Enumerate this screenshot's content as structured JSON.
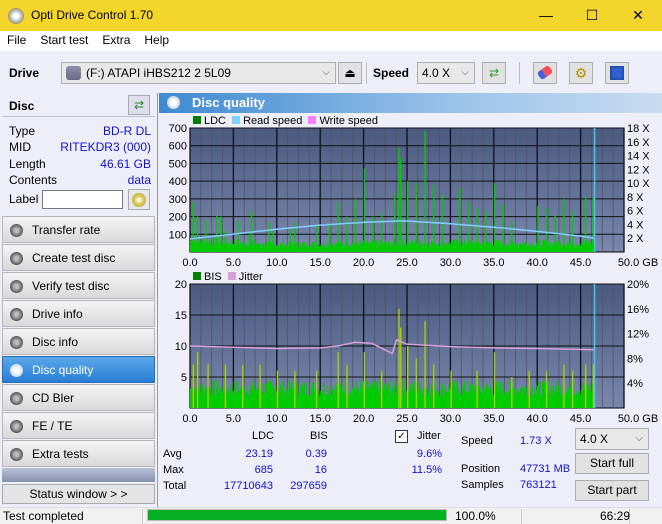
{
  "window": {
    "title": "Opti Drive Control 1.70",
    "minimize": "—",
    "maximize": "☐",
    "close": "✕"
  },
  "menu": [
    "File",
    "Start test",
    "Extra",
    "Help"
  ],
  "toolbar": {
    "drive_label": "Drive",
    "drive_value": "(F:)  ATAPI iHBS212  2 5L09",
    "speed_label": "Speed",
    "speed_value": "4.0 X",
    "eject_glyph": "⏏",
    "chevron": "⌵"
  },
  "disc": {
    "header": "Disc",
    "rows": [
      {
        "key": "Type",
        "value": "BD-R DL"
      },
      {
        "key": "MID",
        "value": "RITEKDR3 (000)"
      },
      {
        "key": "Length",
        "value": "46.61 GB"
      },
      {
        "key": "Contents",
        "value": "data"
      }
    ],
    "label_key": "Label",
    "label_value": ""
  },
  "nav": [
    {
      "label": "Transfer rate",
      "active": false
    },
    {
      "label": "Create test disc",
      "active": false
    },
    {
      "label": "Verify test disc",
      "active": false
    },
    {
      "label": "Drive info",
      "active": false
    },
    {
      "label": "Disc info",
      "active": false
    },
    {
      "label": "Disc quality",
      "active": true
    },
    {
      "label": "CD Bler",
      "active": false
    },
    {
      "label": "FE / TE",
      "active": false
    },
    {
      "label": "Extra tests",
      "active": false
    }
  ],
  "status_window_button": "Status window > >",
  "panel_title": "Disc quality",
  "colors": {
    "ldc": "#008000",
    "read_speed": "#80d0ff",
    "write_speed": "#ff80ff",
    "bis": "#008000",
    "jitter": "#d8a0d8",
    "bar_green": "#00cc00",
    "plot_bg_top": "#4a5a80",
    "plot_bg_bottom": "#7a88b0",
    "link_blue": "#1010d0"
  },
  "chart_data": [
    {
      "type": "bar",
      "title": "LDC / Read speed",
      "legend": [
        "LDC",
        "Read speed",
        "Write speed"
      ],
      "xlabel": "GB",
      "xlim": [
        0,
        50
      ],
      "x_ticks": [
        "0.0",
        "5.0",
        "10.0",
        "15.0",
        "20.0",
        "25.0",
        "30.0",
        "35.0",
        "40.0",
        "45.0",
        "50.0 GB"
      ],
      "ylim": [
        0,
        700
      ],
      "y_ticks": [
        "100",
        "200",
        "300",
        "400",
        "500",
        "600",
        "700"
      ],
      "y2lim": [
        0,
        18
      ],
      "y2_ticks": [
        "2 X",
        "4 X",
        "6 X",
        "8 X",
        "10 X",
        "12 X",
        "14 X",
        "16 X",
        "18 X"
      ],
      "end_marker_gb": 46.61,
      "series": [
        {
          "name": "LDC peaks",
          "x": [
            0.3,
            0.8,
            1.8,
            3.0,
            3.5,
            4.0,
            5.5,
            6.8,
            7.0,
            9.0,
            9.5,
            11.5,
            12.0,
            14.5,
            16.0,
            17.0,
            18.0,
            19.0,
            20.0,
            21.0,
            22.0,
            23.5,
            24.0,
            24.2,
            25.0,
            26.0,
            27.0,
            28.0,
            29.0,
            31.0,
            32.0,
            33.0,
            34.0,
            35.0,
            36.0,
            37.0,
            40.0,
            41.0,
            42.0,
            43.0,
            44.0,
            45.5,
            46.4
          ],
          "values": [
            280,
            200,
            180,
            210,
            200,
            120,
            180,
            100,
            230,
            170,
            120,
            130,
            170,
            150,
            160,
            280,
            200,
            300,
            470,
            200,
            220,
            330,
            590,
            530,
            400,
            390,
            685,
            380,
            320,
            360,
            280,
            250,
            230,
            390,
            270,
            170,
            260,
            250,
            210,
            300,
            230,
            310,
            310
          ]
        },
        {
          "name": "LDC baseline",
          "x": [
            0,
            10,
            20,
            30,
            40,
            46.61
          ],
          "values": [
            60,
            40,
            45,
            50,
            45,
            50
          ]
        },
        {
          "name": "Read speed",
          "x": [
            0,
            5,
            10,
            15,
            20,
            24,
            25,
            30,
            35,
            40,
            45,
            46.61
          ],
          "values": [
            1.9,
            2.6,
            3.3,
            3.9,
            4.3,
            4.5,
            4.5,
            4.1,
            3.6,
            3.0,
            2.3,
            2.0
          ]
        }
      ]
    },
    {
      "type": "bar",
      "title": "BIS / Jitter",
      "legend": [
        "BIS",
        "Jitter"
      ],
      "xlabel": "GB",
      "xlim": [
        0,
        50
      ],
      "x_ticks": [
        "0.0",
        "5.0",
        "10.0",
        "15.0",
        "20.0",
        "25.0",
        "30.0",
        "35.0",
        "40.0",
        "45.0",
        "50.0 GB"
      ],
      "ylim": [
        0,
        20
      ],
      "y_ticks": [
        "5",
        "10",
        "15",
        "20"
      ],
      "y2lim": [
        0,
        20
      ],
      "y2_ticks": [
        "4%",
        "8%",
        "12%",
        "16%",
        "20%"
      ],
      "end_marker_gb": 46.61,
      "series": [
        {
          "name": "BIS peaks",
          "x": [
            0.3,
            0.8,
            2.0,
            4.0,
            6.0,
            8.0,
            10.0,
            12.0,
            14.5,
            17.0,
            18.0,
            20.0,
            22.0,
            24.0,
            24.2,
            25.0,
            26.0,
            27.0,
            28.0,
            30.0,
            33.0,
            35.0,
            37.0,
            39.0,
            41.0,
            43.0,
            44.0,
            45.5,
            46.4
          ],
          "values": [
            7,
            9,
            7,
            7,
            7,
            7,
            6,
            6,
            6,
            9,
            7,
            9,
            6,
            16,
            13,
            10,
            8,
            14,
            7,
            6,
            6,
            9,
            5,
            6,
            6,
            7,
            6,
            7,
            7
          ]
        },
        {
          "name": "BIS baseline",
          "x": [
            0,
            10,
            20,
            30,
            40,
            46.61
          ],
          "values": [
            3,
            3,
            3,
            3,
            3,
            3
          ]
        },
        {
          "name": "Jitter (%)",
          "x": [
            0,
            5,
            10,
            15,
            17,
            19,
            21,
            23.3,
            23.8,
            25,
            30,
            35,
            40,
            46.61
          ],
          "values": [
            10.0,
            9.8,
            9.6,
            9.7,
            10.0,
            10.6,
            10.4,
            8.8,
            11.0,
            10.3,
            9.9,
            9.7,
            9.6,
            9.4
          ]
        }
      ]
    }
  ],
  "stats": {
    "col_ldc": "LDC",
    "col_bis": "BIS",
    "jitter_label": "Jitter",
    "jitter_checked": true,
    "rows": [
      {
        "label": "Avg",
        "ldc": "23.19",
        "bis": "0.39",
        "jitter": "9.6%"
      },
      {
        "label": "Max",
        "ldc": "685",
        "bis": "16",
        "jitter": "11.5%"
      },
      {
        "label": "Total",
        "ldc": "17710643",
        "bis": "297659",
        "jitter": ""
      }
    ],
    "speed_label": "Speed",
    "speed_value": "1.73 X",
    "position_label": "Position",
    "position_value": "47731 MB",
    "samples_label": "Samples",
    "samples_value": "763121",
    "speed_select": "4.0 X",
    "start_full": "Start full",
    "start_part": "Start part"
  },
  "statusbar": {
    "text": "Test completed",
    "progress": 1.0,
    "progress_text": "100.0%",
    "time": "66:29"
  }
}
